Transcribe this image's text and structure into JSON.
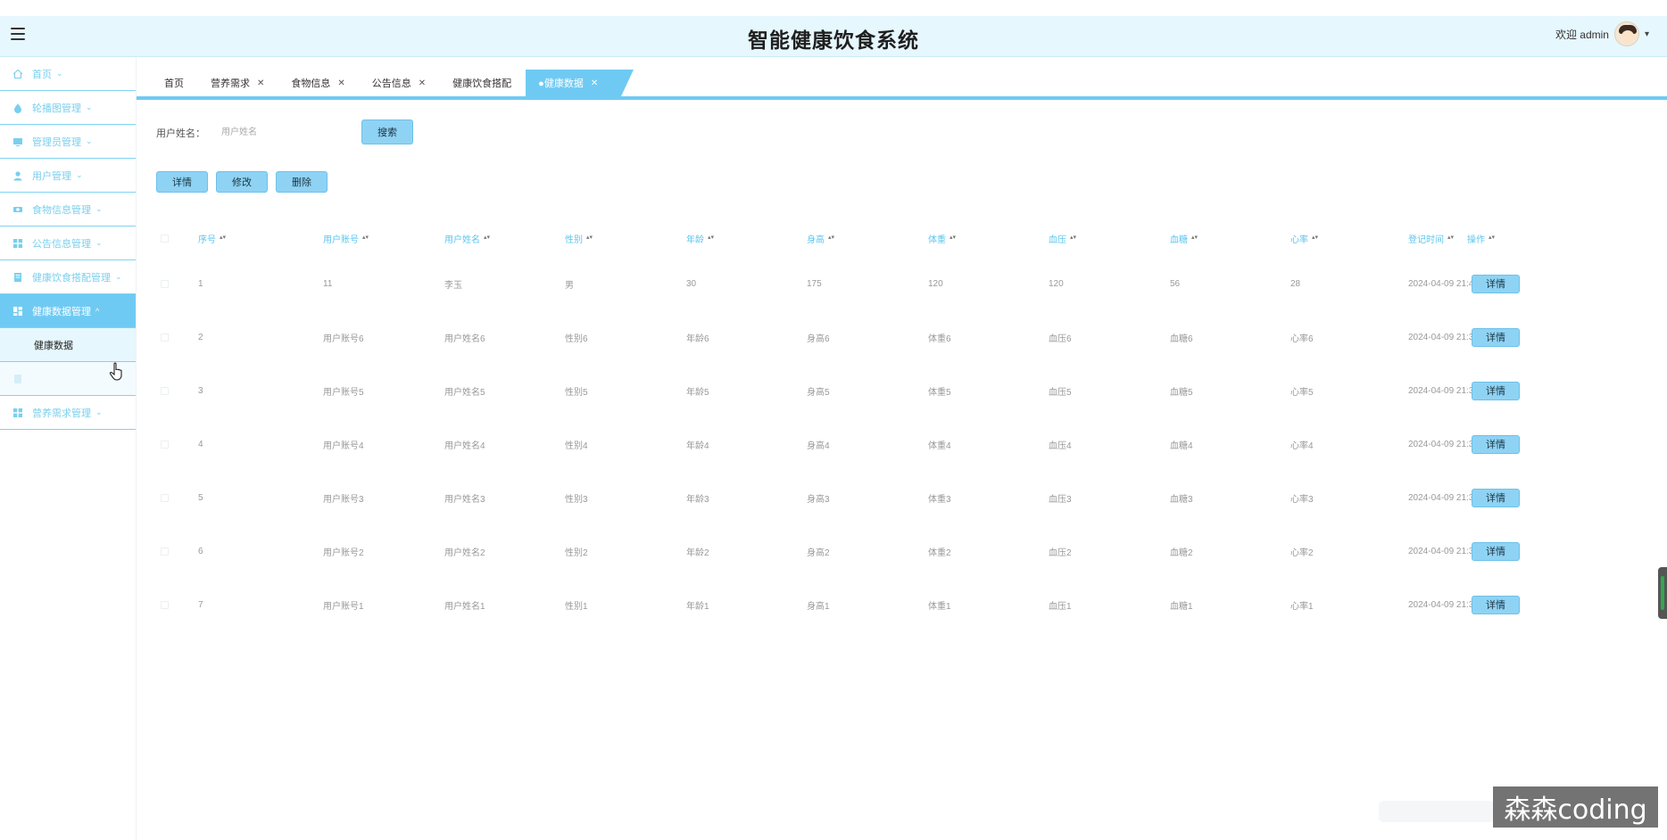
{
  "header": {
    "title": "智能健康饮食系统",
    "welcome": "欢迎 admin"
  },
  "sidebar": {
    "items": [
      {
        "label": "首页",
        "icon": "home-icon"
      },
      {
        "label": "轮播图管理",
        "icon": "drop-icon"
      },
      {
        "label": "管理员管理",
        "icon": "monitor-icon"
      },
      {
        "label": "用户管理",
        "icon": "user-icon"
      },
      {
        "label": "食物信息管理",
        "icon": "food-icon"
      },
      {
        "label": "公告信息管理",
        "icon": "grid-icon"
      },
      {
        "label": "健康饮食搭配管理",
        "icon": "doc-icon"
      },
      {
        "label": "健康数据管理",
        "icon": "dashboard-icon"
      },
      {
        "label": "营养需求管理",
        "icon": "grid-icon"
      }
    ],
    "sub_items": [
      {
        "label": "健康数据"
      }
    ]
  },
  "tabs": [
    {
      "label": "首页",
      "closable": false
    },
    {
      "label": "营养需求",
      "closable": true
    },
    {
      "label": "食物信息",
      "closable": true
    },
    {
      "label": "公告信息",
      "closable": true
    },
    {
      "label": "健康饮食搭配",
      "closable": true
    },
    {
      "label": "●健康数据",
      "closable": true,
      "active": true
    }
  ],
  "search": {
    "label": "用户姓名：",
    "placeholder": "用户姓名",
    "button": "搜索"
  },
  "actions": {
    "detail": "详情",
    "edit": "修改",
    "delete": "删除"
  },
  "table": {
    "columns": [
      "序号",
      "用户账号",
      "用户姓名",
      "性别",
      "年龄",
      "身高",
      "体重",
      "血压",
      "血糖",
      "心率",
      "登记时间",
      "操作"
    ],
    "row_button": "详情",
    "rows": [
      [
        "1",
        "11",
        "李玉",
        "男",
        "30",
        "175",
        "120",
        "120",
        "56",
        "28",
        "2024-04-09 21:44:18"
      ],
      [
        "2",
        "用户账号6",
        "用户姓名6",
        "性别6",
        "年龄6",
        "身高6",
        "体重6",
        "血压6",
        "血糖6",
        "心率6",
        "2024-04-09 21:39:01"
      ],
      [
        "3",
        "用户账号5",
        "用户姓名5",
        "性别5",
        "年龄5",
        "身高5",
        "体重5",
        "血压5",
        "血糖5",
        "心率5",
        "2024-04-09 21:39:01"
      ],
      [
        "4",
        "用户账号4",
        "用户姓名4",
        "性别4",
        "年龄4",
        "身高4",
        "体重4",
        "血压4",
        "血糖4",
        "心率4",
        "2024-04-09 21:39:01"
      ],
      [
        "5",
        "用户账号3",
        "用户姓名3",
        "性别3",
        "年龄3",
        "身高3",
        "体重3",
        "血压3",
        "血糖3",
        "心率3",
        "2024-04-09 21:39:01"
      ],
      [
        "6",
        "用户账号2",
        "用户姓名2",
        "性别2",
        "年龄2",
        "身高2",
        "体重2",
        "血压2",
        "血糖2",
        "心率2",
        "2024-04-09 21:39:01"
      ],
      [
        "7",
        "用户账号1",
        "用户姓名1",
        "性别1",
        "年龄1",
        "身高1",
        "体重1",
        "血压1",
        "血糖1",
        "心率1",
        "2024-04-09 21:39:01"
      ]
    ]
  },
  "watermark": "森森coding",
  "colors": {
    "accent": "#6fcaf3",
    "header_bg": "#e6f7fd",
    "button": "#8fd3f4"
  }
}
